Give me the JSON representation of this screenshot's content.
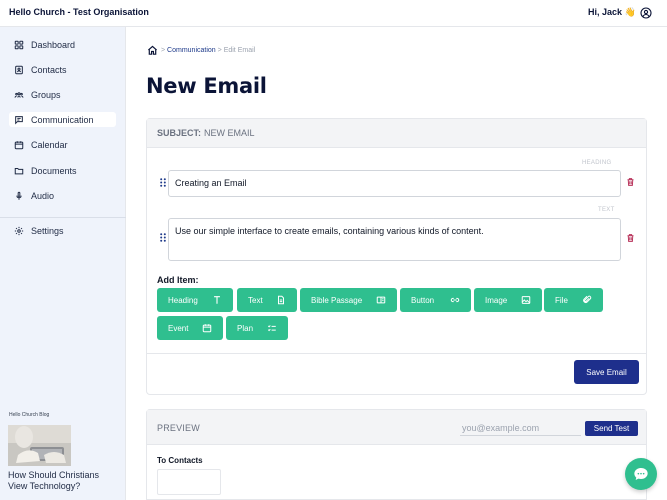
{
  "header": {
    "org_title": "Hello Church - Test Organisation",
    "greeting": "Hi, Jack 👋"
  },
  "sidebar": {
    "items": [
      {
        "label": "Dashboard",
        "icon": "grid-icon"
      },
      {
        "label": "Contacts",
        "icon": "address-book-icon"
      },
      {
        "label": "Groups",
        "icon": "users-icon"
      },
      {
        "label": "Communication",
        "icon": "message-icon"
      },
      {
        "label": "Calendar",
        "icon": "calendar-icon"
      },
      {
        "label": "Documents",
        "icon": "folder-icon"
      },
      {
        "label": "Audio",
        "icon": "microphone-icon"
      },
      {
        "label": "Settings",
        "icon": "gear-icon"
      }
    ],
    "active": "Communication",
    "blog_label": "Hello Church Blog",
    "blog_title": "How Should Christians View Technology?"
  },
  "breadcrumb": {
    "link": "Communication",
    "sep": ">",
    "current": "Edit Email"
  },
  "page_title": "New Email",
  "editor": {
    "subject_label": "Subject:",
    "subject_value": "New Email",
    "heading_tag": "Heading",
    "heading_value": "Creating an Email",
    "text_tag": "Text",
    "text_value": "Use our simple interface to create emails, containing various kinds of content.",
    "add_item_label": "Add Item:",
    "item_buttons": [
      "Heading",
      "Text",
      "Bible Passage",
      "Button",
      "Image",
      "File",
      "Event",
      "Plan"
    ],
    "save_label": "Save Email"
  },
  "preview": {
    "title": "Preview",
    "email_placeholder": "you@example.com",
    "send_label": "Send Test",
    "to_contacts": "To Contacts"
  },
  "colors": {
    "accent_green": "#2fbf8f",
    "navy": "#1e2f8c",
    "sidebar_bg": "#eff3fb",
    "trash_red": "#b8325a"
  }
}
